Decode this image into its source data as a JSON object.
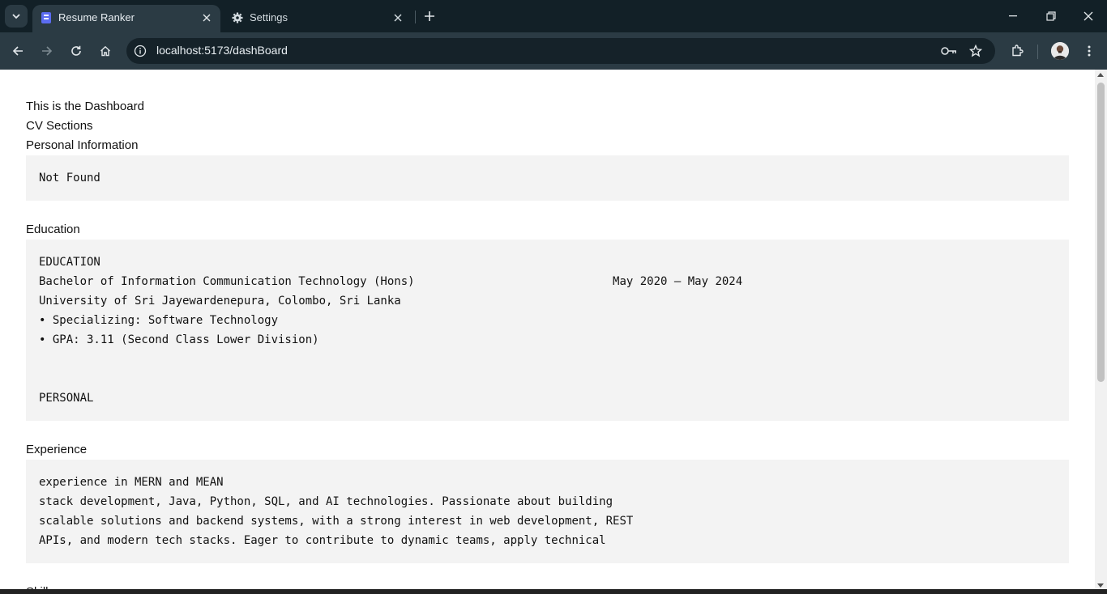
{
  "browser": {
    "tabs": [
      {
        "title": "Resume Ranker",
        "active": true
      },
      {
        "title": "Settings",
        "active": false
      }
    ],
    "url": "localhost:5173/dashBoard"
  },
  "page": {
    "dashboard_title": "This is the Dashboard",
    "cv_sections_label": "CV Sections",
    "personal": {
      "heading": "Personal Information",
      "content": "Not Found"
    },
    "education": {
      "heading": "Education",
      "content": "EDUCATION\nBachelor of Information Communication Technology (Hons)                             May 2020 – May 2024\nUniversity of Sri Jayewardenepura, Colombo, Sri Lanka\n• Specializing: Software Technology\n• GPA: 3.11 (Second Class Lower Division)\n\n\nPERSONAL"
    },
    "experience": {
      "heading": "Experience",
      "content": "experience in MERN and MEAN\nstack development, Java, Python, SQL, and AI technologies. Passionate about building\nscalable solutions and backend systems, with a strong interest in web development, REST\nAPIs, and modern tech stacks. Eager to contribute to dynamic teams, apply technical"
    },
    "skills": {
      "heading": "Skills"
    }
  },
  "colors": {
    "tabstrip_bg": "#122027",
    "toolbar_bg": "#2b3b44",
    "pre_bg": "#f3f3f3"
  }
}
